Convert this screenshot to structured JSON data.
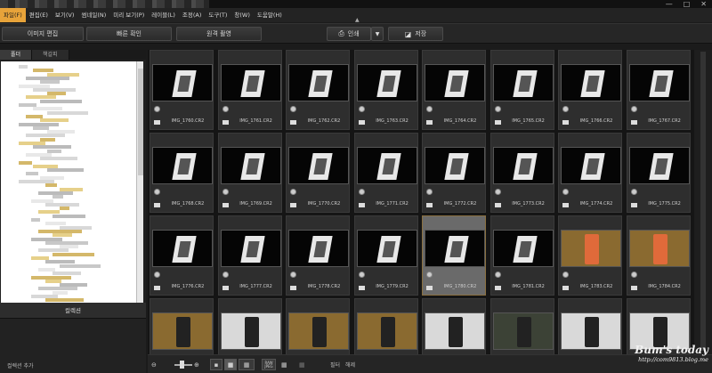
{
  "menu": {
    "items": [
      {
        "label": "파일(F)",
        "active": true
      },
      {
        "label": "편집(E)"
      },
      {
        "label": "보기(V)"
      },
      {
        "label": "썸네일(N)"
      },
      {
        "label": "미리 보기(P)"
      },
      {
        "label": "레이블(L)"
      },
      {
        "label": "조정(A)"
      },
      {
        "label": "도구(T)"
      },
      {
        "label": "창(W)"
      },
      {
        "label": "도움말(H)"
      }
    ]
  },
  "window": {
    "min": "—",
    "max": "□",
    "close": "✕"
  },
  "toolbar": {
    "edit_image": "이미지 편집",
    "quick_check": "빠른 확인",
    "remote_shoot": "원격 촬영",
    "print": "인쇄",
    "save": "저장"
  },
  "leftpanel": {
    "tab_folder": "폴더",
    "tab_bookmark": "책갈피",
    "collection_title": "컬렉션",
    "collection_add": "컬렉션 추가"
  },
  "thumbnails": [
    "IMG_1760.CR2",
    "IMG_1761.CR2",
    "IMG_1762.CR2",
    "IMG_1763.CR2",
    "IMG_1764.CR2",
    "IMG_1765.CR2",
    "IMG_1766.CR2",
    "IMG_1767.CR2",
    "IMG_1768.CR2",
    "IMG_1769.CR2",
    "IMG_1770.CR2",
    "IMG_1771.CR2",
    "IMG_1772.CR2",
    "IMG_1773.CR2",
    "IMG_1774.CR2",
    "IMG_1775.CR2",
    "IMG_1776.CR2",
    "IMG_1777.CR2",
    "IMG_1778.CR2",
    "IMG_1779.CR2",
    "IMG_1780.CR2",
    "IMG_1781.CR2",
    "IMG_1783.CR2",
    "IMG_1784.CR2",
    "",
    "",
    "",
    "",
    "",
    "",
    "",
    ""
  ],
  "selected_thumbnail": "IMG_1780.CR2",
  "bottombar": {
    "raw_label": "RAW",
    "raw_sub": "JPEG",
    "filter_label": "필터",
    "clear_label": "해제"
  },
  "watermark": {
    "title": "Bum's today",
    "url": "http://com9813.blog.me"
  },
  "colors": {
    "accent": "#e7a33a",
    "background": "#1b1b1b"
  }
}
